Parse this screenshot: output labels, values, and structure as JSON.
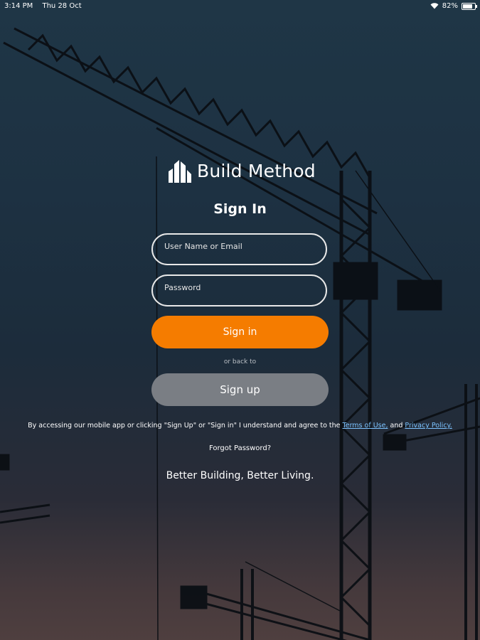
{
  "status_bar": {
    "time": "3:14 PM",
    "date": "Thu 28 Oct",
    "battery": "82%"
  },
  "brand": {
    "name": "Build Method"
  },
  "form": {
    "title": "Sign In",
    "username_placeholder": "User Name or Email",
    "password_placeholder": "Password",
    "signin_label": "Sign in",
    "or_text": "or back to",
    "signup_label": "Sign up"
  },
  "legal": {
    "text": "By accessing our mobile app or clicking \"Sign Up\" or \"Sign in\" I understand and agree to the",
    "terms_link": "Terms of Use,",
    "and": "and",
    "privacy_link": "Privacy Policy."
  },
  "forgot_password": "Forgot Password?",
  "tagline": "Better Building, Better Living.",
  "colors": {
    "accent": "#f57c00",
    "secondary_button": "#7a7e84",
    "link": "#7cc3ff"
  }
}
